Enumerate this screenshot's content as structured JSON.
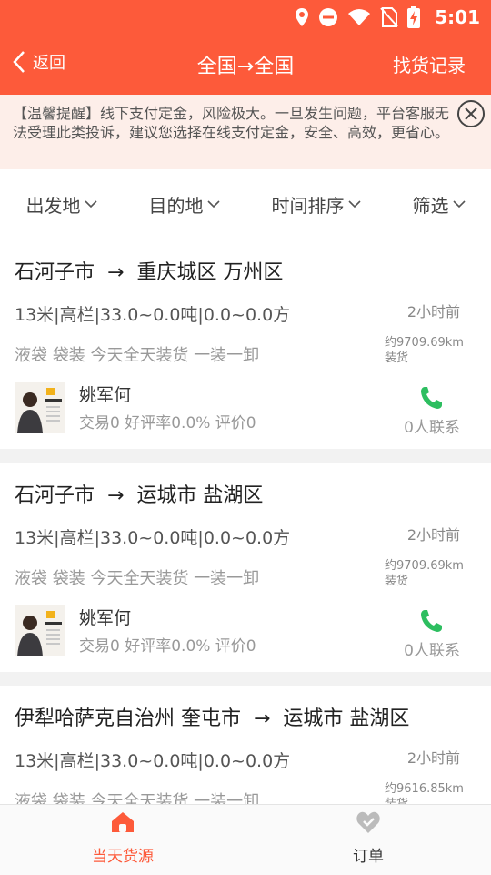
{
  "status_bar": {
    "time": "5:01"
  },
  "header": {
    "back_label": "返回",
    "title": "全国→全国",
    "records_label": "找货记录"
  },
  "notice": {
    "text": "【温馨提醒】线下支付定金，风险极大。一旦发生问题，平台客服无法受理此类投诉，建议您选择在线支付定金，安全、高效，更省心。"
  },
  "filters": [
    {
      "label": "出发地"
    },
    {
      "label": "目的地"
    },
    {
      "label": "时间排序"
    },
    {
      "label": "筛选"
    }
  ],
  "cards": [
    {
      "origin": "石河子市",
      "destination": "重庆城区 万州区",
      "specs": "13米|高栏|33.0~0.0吨|0.0~0.0方",
      "time_ago": "2小时前",
      "tags": "液袋 袋装 今天全天装货 一装一卸",
      "distance": "约9709.69km",
      "load_label": "装货",
      "user": "姚军何",
      "stats": "交易0  好评率0.0%  评价0",
      "contacts": "0人联系"
    },
    {
      "origin": "石河子市",
      "destination": "运城市 盐湖区",
      "specs": "13米|高栏|33.0~0.0吨|0.0~0.0方",
      "time_ago": "2小时前",
      "tags": "液袋 袋装 今天全天装货 一装一卸",
      "distance": "约9709.69km",
      "load_label": "装货",
      "user": "姚军何",
      "stats": "交易0  好评率0.0%  评价0",
      "contacts": "0人联系"
    },
    {
      "origin": "伊犁哈萨克自治州 奎屯市",
      "destination": "运城市 盐湖区",
      "specs": "13米|高栏|33.0~0.0吨|0.0~0.0方",
      "time_ago": "2小时前",
      "tags": "液袋 袋装 今天全天装货 一装一卸",
      "distance": "约9616.85km",
      "load_label": "装货",
      "user": "",
      "stats": "",
      "contacts": ""
    }
  ],
  "tabbar": {
    "tabs": [
      {
        "label": "当天货源",
        "active": true
      },
      {
        "label": "订单",
        "active": false
      }
    ]
  },
  "colors": {
    "brand": "#fd5a3a",
    "phone_green": "#2dbe60",
    "inactive_tab": "#bbbbbb"
  }
}
